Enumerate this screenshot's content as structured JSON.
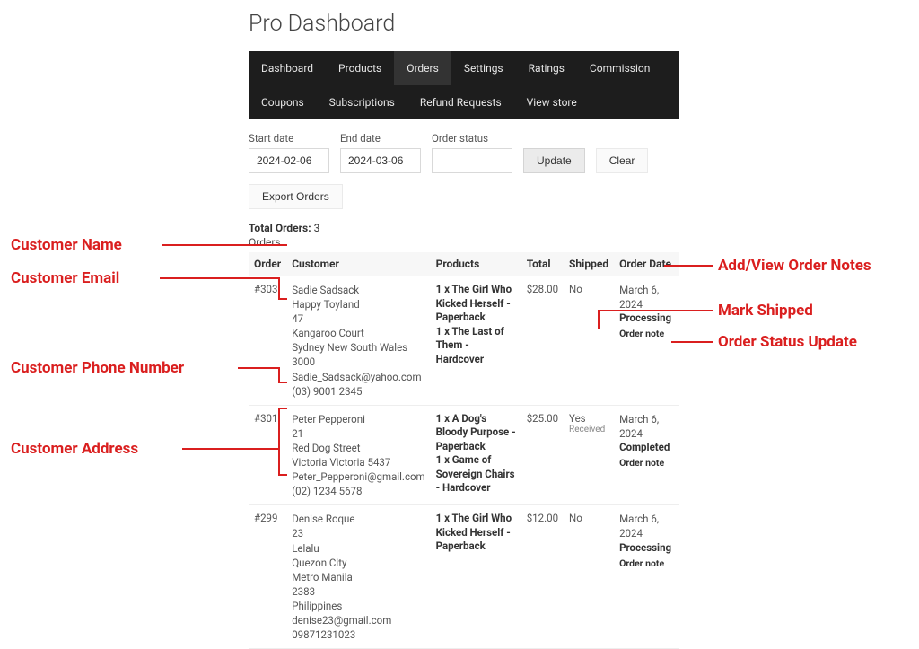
{
  "title": "Pro Dashboard",
  "tabs": [
    "Dashboard",
    "Products",
    "Orders",
    "Settings",
    "Ratings",
    "Commission",
    "Coupons",
    "Subscriptions",
    "Refund Requests",
    "View store"
  ],
  "active_tab_index": 2,
  "filters": {
    "start_label": "Start date",
    "start_value": "2024-02-06",
    "end_label": "End date",
    "end_value": "2024-03-06",
    "status_label": "Order status",
    "status_value": "",
    "update_btn": "Update",
    "clear_btn": "Clear",
    "export_btn": "Export Orders"
  },
  "totals": {
    "label": "Total Orders:",
    "count": "3"
  },
  "table": {
    "caption": "Orders",
    "headers": [
      "Order",
      "Customer",
      "Products",
      "Total",
      "Shipped",
      "Order Date"
    ]
  },
  "orders": [
    {
      "id": "#303",
      "customer": [
        "Sadie Sadsack",
        "Happy Toyland",
        "47",
        "Kangaroo Court",
        "Sydney New South Wales",
        "3000",
        "Sadie_Sadsack@yahoo.com",
        "(03) 9001 2345"
      ],
      "products": [
        "1 x The Girl Who Kicked Herself - Paperback",
        "1 x The Last of Them - Hardcover"
      ],
      "total": "$28.00",
      "shipped": "No",
      "shipped_extra": "",
      "date": "March 6, 2024",
      "status": "Processing",
      "note": "Order note"
    },
    {
      "id": "#301",
      "customer": [
        "Peter Pepperoni",
        "21",
        "Red Dog Street",
        "Victoria Victoria 5437",
        "Peter_Pepperoni@gmail.com",
        "(02) 1234 5678"
      ],
      "products": [
        "1 x A Dog's Bloody Purpose - Paperback",
        "1 x Game of Sovereign Chairs - Hardcover"
      ],
      "total": "$25.00",
      "shipped": "Yes",
      "shipped_extra": "Received",
      "date": "March 6, 2024",
      "status": "Completed",
      "note": "Order note"
    },
    {
      "id": "#299",
      "customer": [
        "Denise Roque",
        "23",
        "Lelalu",
        "Quezon City",
        "Metro Manila",
        "2383",
        "Philippines",
        "denise23@gmail.com",
        "09871231023"
      ],
      "products": [
        "1 x The Girl Who Kicked Herself - Paperback"
      ],
      "total": "$12.00",
      "shipped": "No",
      "shipped_extra": "",
      "date": "March 6, 2024",
      "status": "Processing",
      "note": "Order note"
    }
  ],
  "annotations": {
    "customer_name": "Customer Name",
    "customer_email": "Customer Email",
    "customer_phone": "Customer Phone Number",
    "customer_address": "Customer Address",
    "add_notes": "Add/View Order Notes",
    "mark_shipped": "Mark Shipped",
    "status_update": "Order Status Update"
  }
}
